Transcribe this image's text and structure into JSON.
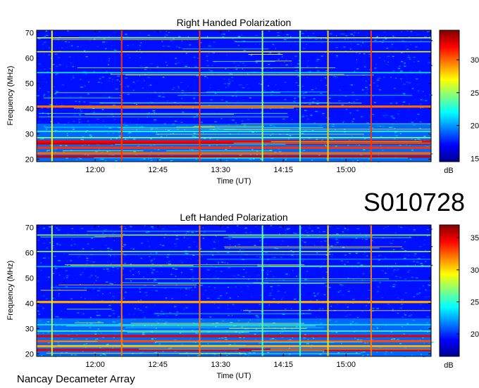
{
  "identifier": "S010728",
  "footer": "Nancay Decameter Array",
  "chart_data": [
    {
      "type": "heatmap",
      "title": "Right Handed Polarization",
      "xlabel": "Time (UT)",
      "ylabel": "Frequency (MHz)",
      "xticks": [
        "12:00",
        "12:45",
        "13:30",
        "14:15",
        "15:00"
      ],
      "xtick_minutes": [
        720,
        765,
        810,
        855,
        900
      ],
      "xlim_minutes": [
        678,
        961
      ],
      "ylim": [
        19,
        71
      ],
      "yticks": [
        20,
        30,
        40,
        50,
        60,
        70
      ],
      "colorbar": {
        "label": "dB",
        "range": [
          14.5,
          34.5
        ],
        "ticks": [
          15,
          20,
          25,
          30
        ]
      },
      "bands_mhz": [
        {
          "f": 21.0,
          "level": 33
        },
        {
          "f": 22.3,
          "level": 30
        },
        {
          "f": 24.5,
          "level": 31
        },
        {
          "f": 26.2,
          "level": 33
        },
        {
          "f": 27.0,
          "level": 32
        },
        {
          "f": 28.5,
          "level": 25
        },
        {
          "f": 31.0,
          "level": 23
        },
        {
          "f": 40.8,
          "level": 30
        },
        {
          "f": 54.2,
          "level": 22
        },
        {
          "f": 62.5,
          "level": 27
        },
        {
          "f": 68.0,
          "level": 26
        }
      ],
      "vertical_events_minutes": [
        {
          "t": 689,
          "level": 27
        },
        {
          "t": 739,
          "level": 31
        },
        {
          "t": 795,
          "level": 31
        },
        {
          "t": 840,
          "level": 25
        },
        {
          "t": 867,
          "level": 24
        },
        {
          "t": 887,
          "level": 28
        },
        {
          "t": 918,
          "level": 31
        }
      ]
    },
    {
      "type": "heatmap",
      "title": "Left Handed Polarization",
      "xlabel": "Time (UT)",
      "ylabel": "Frequency (MHz)",
      "xticks": [
        "12:00",
        "12:45",
        "13:30",
        "14:15",
        "15:00"
      ],
      "xtick_minutes": [
        720,
        765,
        810,
        855,
        900
      ],
      "xlim_minutes": [
        678,
        961
      ],
      "ylim": [
        19,
        71
      ],
      "yticks": [
        20,
        30,
        40,
        50,
        60,
        70
      ],
      "colorbar": {
        "label": "dB",
        "range": [
          16.5,
          37
        ],
        "ticks": [
          20,
          25,
          30,
          35
        ]
      },
      "bands_mhz": [
        {
          "f": 21.5,
          "level": 35
        },
        {
          "f": 23.0,
          "level": 31
        },
        {
          "f": 25.0,
          "level": 33
        },
        {
          "f": 27.0,
          "level": 35
        },
        {
          "f": 29.0,
          "level": 26
        },
        {
          "f": 31.5,
          "level": 24
        },
        {
          "f": 40.5,
          "level": 31
        },
        {
          "f": 54.5,
          "level": 23
        },
        {
          "f": 60.5,
          "level": 27
        },
        {
          "f": 67.0,
          "level": 27
        }
      ],
      "vertical_events_minutes": [
        {
          "t": 689,
          "level": 28
        },
        {
          "t": 739,
          "level": 32
        },
        {
          "t": 795,
          "level": 32
        },
        {
          "t": 840,
          "level": 26
        },
        {
          "t": 867,
          "level": 25
        },
        {
          "t": 887,
          "level": 30
        },
        {
          "t": 918,
          "level": 32
        }
      ]
    }
  ]
}
